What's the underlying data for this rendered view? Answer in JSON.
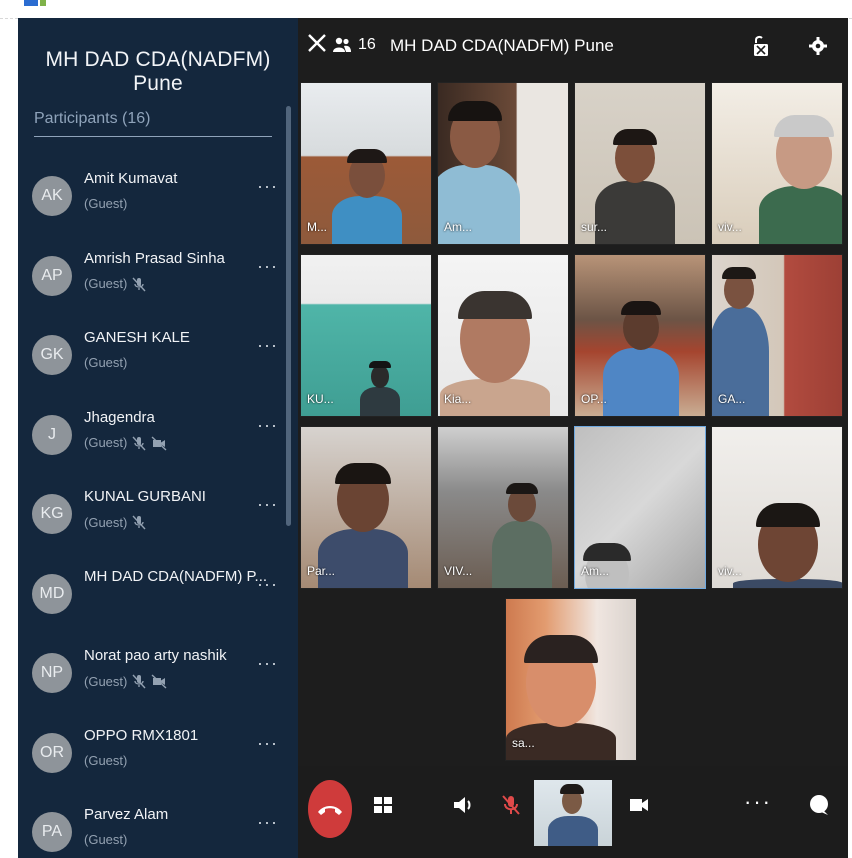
{
  "meeting_title": "MH DAD CDA(NADFM) Pune",
  "participant_count": "16",
  "participants_header": "Participants (16)",
  "more_glyph": "···",
  "participants": [
    {
      "initials": "AK",
      "name": "Amit Kumavat",
      "role": "(Guest)",
      "mic_muted": false,
      "cam_off": false
    },
    {
      "initials": "AP",
      "name": "Amrish Prasad Sinha",
      "role": "(Guest)",
      "mic_muted": true,
      "cam_off": false
    },
    {
      "initials": "GK",
      "name": "GANESH KALE",
      "role": "(Guest)",
      "mic_muted": false,
      "cam_off": false
    },
    {
      "initials": "J",
      "name": "Jhagendra",
      "role": "(Guest)",
      "mic_muted": true,
      "cam_off": true
    },
    {
      "initials": "KG",
      "name": "KUNAL GURBANI",
      "role": "(Guest)",
      "mic_muted": true,
      "cam_off": false
    },
    {
      "initials": "MD",
      "name": "MH DAD CDA(NADFM) P...",
      "role": "",
      "mic_muted": false,
      "cam_off": false
    },
    {
      "initials": "NP",
      "name": "Norat pao arty nashik",
      "role": "(Guest)",
      "mic_muted": true,
      "cam_off": true
    },
    {
      "initials": "OR",
      "name": "OPPO RMX1801",
      "role": "(Guest)",
      "mic_muted": false,
      "cam_off": false
    },
    {
      "initials": "PA",
      "name": "Parvez Alam",
      "role": "(Guest)",
      "mic_muted": false,
      "cam_off": false
    }
  ],
  "video_tiles": [
    "M...",
    "Am...",
    "sur...",
    "viv...",
    "KU...",
    "Kia...",
    "OP...",
    "GA...",
    "Par...",
    "VIV...",
    "Am...",
    "viv...",
    "sa..."
  ],
  "colors": {
    "sidebar_bg": "#14273d",
    "main_bg": "#1d1d1d",
    "end_call": "#cf3b3b",
    "avatar": "#8e949a",
    "mute_red": "#e04a4a"
  },
  "icons": {
    "close": "close-icon",
    "participants": "people-icon",
    "lock": "lock-icon",
    "settings": "gear-icon",
    "end_call": "phone-hangup-icon",
    "layout": "grid-icon",
    "speaker": "speaker-icon",
    "mic": "mic-off-icon",
    "camera": "video-camera-icon",
    "more": "more-icon",
    "chat": "chat-icon"
  }
}
